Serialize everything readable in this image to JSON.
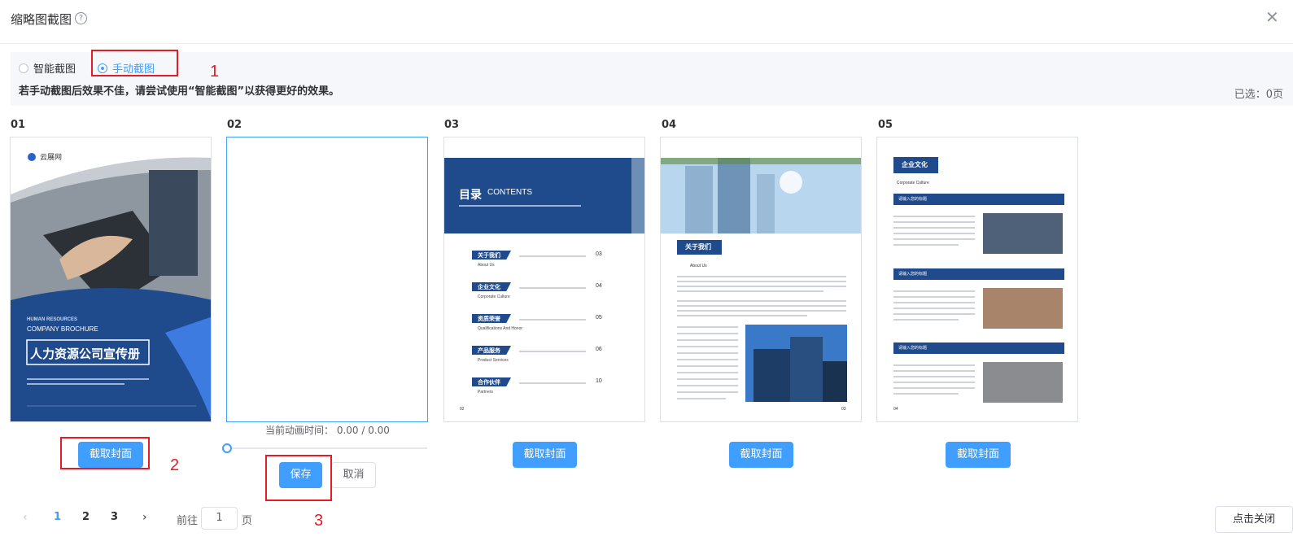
{
  "dialog": {
    "title": "缩略图截图",
    "help_icon": "question-circle-icon",
    "close_icon": "close-icon"
  },
  "mode": {
    "options": [
      {
        "label": "智能截图",
        "selected": false
      },
      {
        "label": "手动截图",
        "selected": true
      }
    ],
    "hint": "若手动截图后效果不佳，请尝试使用“智能截图”以获得更好的效果。",
    "selected_count": "已选：0页"
  },
  "pages": [
    {
      "label": "01",
      "button": "截取封面",
      "cover": {
        "logo": "云展网",
        "en1": "HUMAN RESOURCES",
        "en2": "COMPANY BROCHURE",
        "title": "人力资源公司宣传册"
      }
    },
    {
      "label": "02",
      "editing": true
    },
    {
      "label": "03",
      "button": "截取封面",
      "toc": {
        "title": "目录",
        "title_en": "CONTENTS",
        "items": [
          {
            "cn": "关于我们",
            "en": "About Us",
            "num": "03"
          },
          {
            "cn": "企业文化",
            "en": "Corporate Culture",
            "num": "04"
          },
          {
            "cn": "资质荣誉",
            "en": "Qualifications And Honor",
            "num": "05"
          },
          {
            "cn": "产品服务",
            "en": "Product Services",
            "num": "06"
          },
          {
            "cn": "合作伙伴",
            "en": "Partners",
            "num": "10"
          }
        ],
        "page_no": "02"
      }
    },
    {
      "label": "04",
      "button": "截取封面",
      "about": {
        "title": "关于我们",
        "sub": "About Us",
        "page_no": "03"
      }
    },
    {
      "label": "05",
      "button": "截取封面",
      "culture": {
        "title": "企业文化",
        "sub": "Corporate Culture",
        "section": "请输入您的标题",
        "page_no": "04"
      }
    }
  ],
  "editor": {
    "anim_time": "当前动画时间： 0.00 / 0.00",
    "anim_progress": 0,
    "save": "保存",
    "cancel": "取消"
  },
  "annotations": [
    "1",
    "2",
    "3"
  ],
  "pagination": {
    "pages": [
      "1",
      "2",
      "3"
    ],
    "current": "1",
    "goto_label": "前往",
    "goto_value": "1",
    "goto_unit": "页"
  },
  "close_button": "点击关闭",
  "colors": {
    "primary": "#409eff",
    "annotation": "#e51c23",
    "brochure_navy": "#1f4a8c"
  }
}
